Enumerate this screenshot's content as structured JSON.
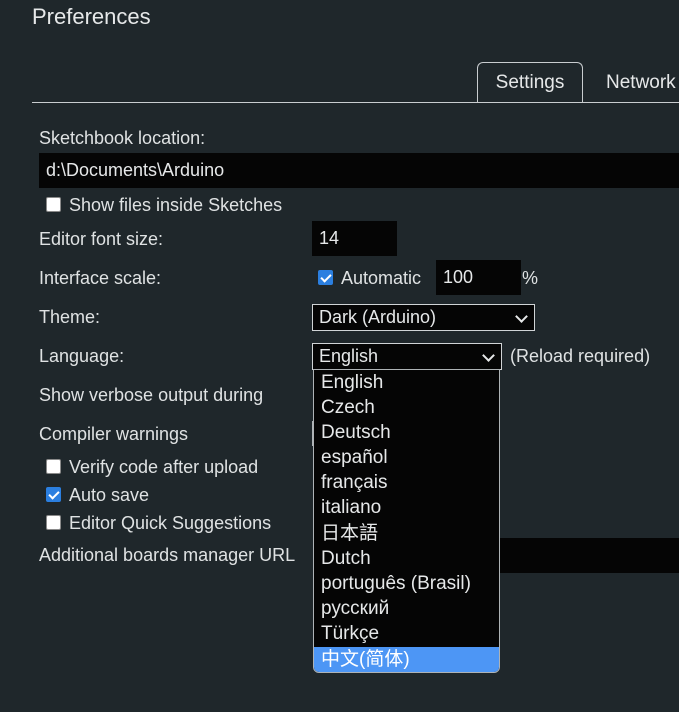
{
  "window": {
    "title": "Preferences"
  },
  "tabs": [
    {
      "label": "Settings",
      "active": true
    },
    {
      "label": "Network",
      "active": false
    }
  ],
  "settings": {
    "sketchbook_label": "Sketchbook location:",
    "sketchbook_value": "d:\\Documents\\Arduino",
    "show_files_label": "Show files inside Sketches",
    "show_files_checked": false,
    "font_size_label": "Editor font size:",
    "font_size_value": "14",
    "scale_label": "Interface scale:",
    "scale_auto_label": "Automatic",
    "scale_auto_checked": true,
    "scale_value": "100",
    "scale_unit": "%",
    "theme_label": "Theme:",
    "theme_value": "Dark (Arduino)",
    "language_label": "Language:",
    "language_value": "English",
    "reload_note": "(Reload required)",
    "verbose_label": "Show verbose output during",
    "compiler_label": "Compiler warnings",
    "verify_label": "Verify code after upload",
    "verify_checked": false,
    "autosave_label": "Auto save",
    "autosave_checked": true,
    "quick_label": "Editor Quick Suggestions",
    "quick_checked": false,
    "boards_label": "Additional boards manager URL"
  },
  "language_options": [
    "English",
    "Czech",
    "Deutsch",
    "español",
    "français",
    "italiano",
    "日本語",
    "Dutch",
    "português (Brasil)",
    "русский",
    "Türkçe",
    "中文(简体)"
  ],
  "highlighted_option": "中文(简体)",
  "colors": {
    "background": "#1f272b",
    "field": "#050505",
    "accent": "#2b7fe0",
    "highlight": "#4d96f5"
  }
}
